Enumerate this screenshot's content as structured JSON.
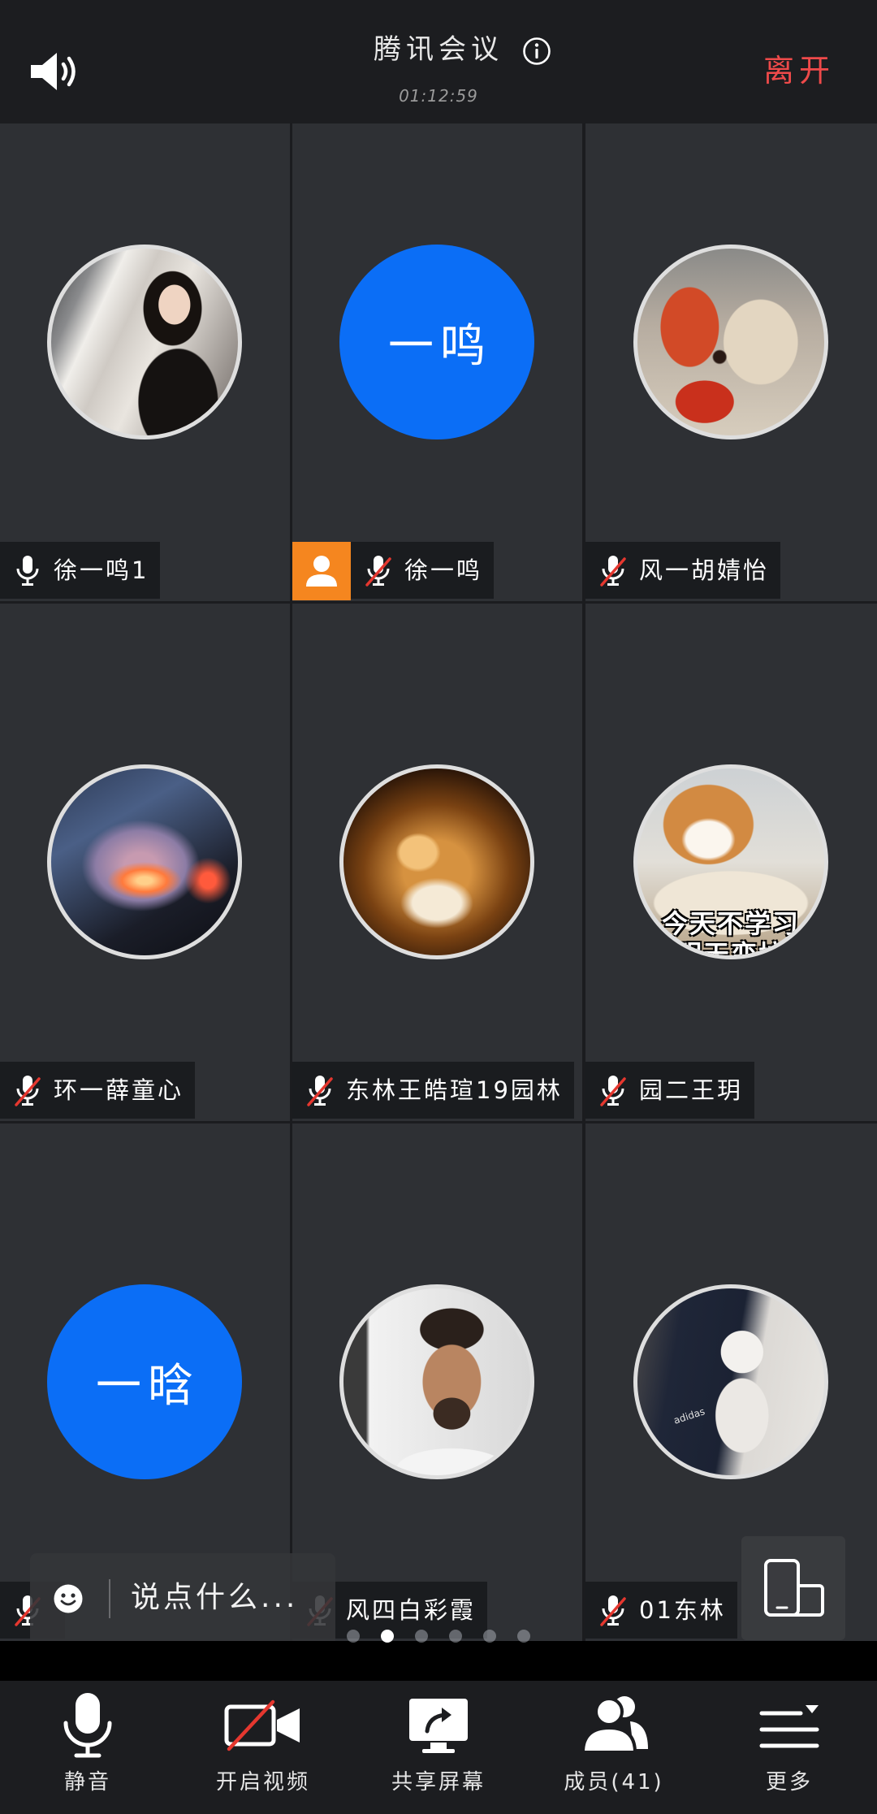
{
  "app": {
    "title": "腾讯会议",
    "elapsed": "01:12:59",
    "leave_label": "离开"
  },
  "header": {
    "speaker_icon": "speaker-icon",
    "info_icon": "info-icon"
  },
  "participants": [
    {
      "name": "徐一鸣1",
      "muted": false
    },
    {
      "name": "徐一鸣",
      "muted": true,
      "badge_icon": "person-icon",
      "avatar_text": "一鸣"
    },
    {
      "name": "风一胡婧怡",
      "muted": true
    },
    {
      "name": "环一薛童心",
      "muted": true
    },
    {
      "name": "东林王皓瑄19园林",
      "muted": true
    },
    {
      "name": "园二王玥",
      "muted": true,
      "avatar_caption": [
        "今天不学习",
        "明天变垃"
      ]
    },
    {
      "muted": true,
      "avatar_text": "一晗"
    },
    {
      "name": "风四白彩霞",
      "muted": true
    },
    {
      "name": "01东林",
      "muted": true,
      "avatar_logo_text": "adidas"
    }
  ],
  "chat": {
    "placeholder": "说点什么...",
    "emoji_icon": "smiley-icon"
  },
  "orientation_icon": "rotate-screen-icon",
  "pager": {
    "pages": 6,
    "current": 2
  },
  "toolbar": {
    "items": [
      {
        "label": "静音",
        "icon": "microphone-icon"
      },
      {
        "label": "开启视频",
        "icon": "video-off-icon"
      },
      {
        "label": "共享屏幕",
        "icon": "share-screen-icon"
      },
      {
        "label": "成员(41)",
        "icon": "members-icon"
      },
      {
        "label": "更多",
        "icon": "more-menu-icon"
      }
    ]
  },
  "colors": {
    "avatar_blue": "#0b6ef6",
    "leave_red": "#ef4a4a",
    "host_orange": "#f5861f",
    "muted_slash": "#e5372f"
  }
}
